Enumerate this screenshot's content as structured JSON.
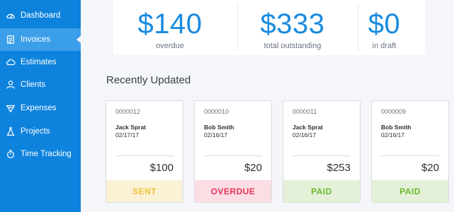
{
  "sidebar": {
    "items": [
      {
        "label": "Dashboard",
        "icon": "dashboard-gauge-icon"
      },
      {
        "label": "Invoices",
        "icon": "invoice-icon"
      },
      {
        "label": "Estimates",
        "icon": "estimate-cloud-icon"
      },
      {
        "label": "Clients",
        "icon": "clients-icon"
      },
      {
        "label": "Expenses",
        "icon": "expenses-icon"
      },
      {
        "label": "Projects",
        "icon": "projects-flask-icon"
      },
      {
        "label": "Time Tracking",
        "icon": "stopwatch-icon"
      }
    ],
    "active_index": 1
  },
  "summary": {
    "overdue": {
      "amount": "$140",
      "label": "overdue"
    },
    "outstanding": {
      "amount": "$333",
      "label": "total outstanding"
    },
    "draft": {
      "amount": "$0",
      "label": "in draft"
    }
  },
  "recent": {
    "title": "Recently Updated",
    "cards": [
      {
        "number": "0000012",
        "client": "Jack Sprat",
        "date": "02/17/17",
        "amount": "$100",
        "status": "SENT",
        "status_color": "#f0c23a",
        "status_bg": "#fbf2d6"
      },
      {
        "number": "0000010",
        "client": "Bob Smith",
        "date": "02/16/17",
        "amount": "$20",
        "status": "OVERDUE",
        "status_color": "#e8345a",
        "status_bg": "#fbdde4"
      },
      {
        "number": "0000011",
        "client": "Jack Sprat",
        "date": "02/16/17",
        "amount": "$253",
        "status": "PAID",
        "status_color": "#6cba2e",
        "status_bg": "#e4f1d8"
      },
      {
        "number": "0000009",
        "client": "Bob Smith",
        "date": "02/16/17",
        "amount": "$20",
        "status": "PAID",
        "status_color": "#6cba2e",
        "status_bg": "#e4f1d8"
      }
    ]
  }
}
